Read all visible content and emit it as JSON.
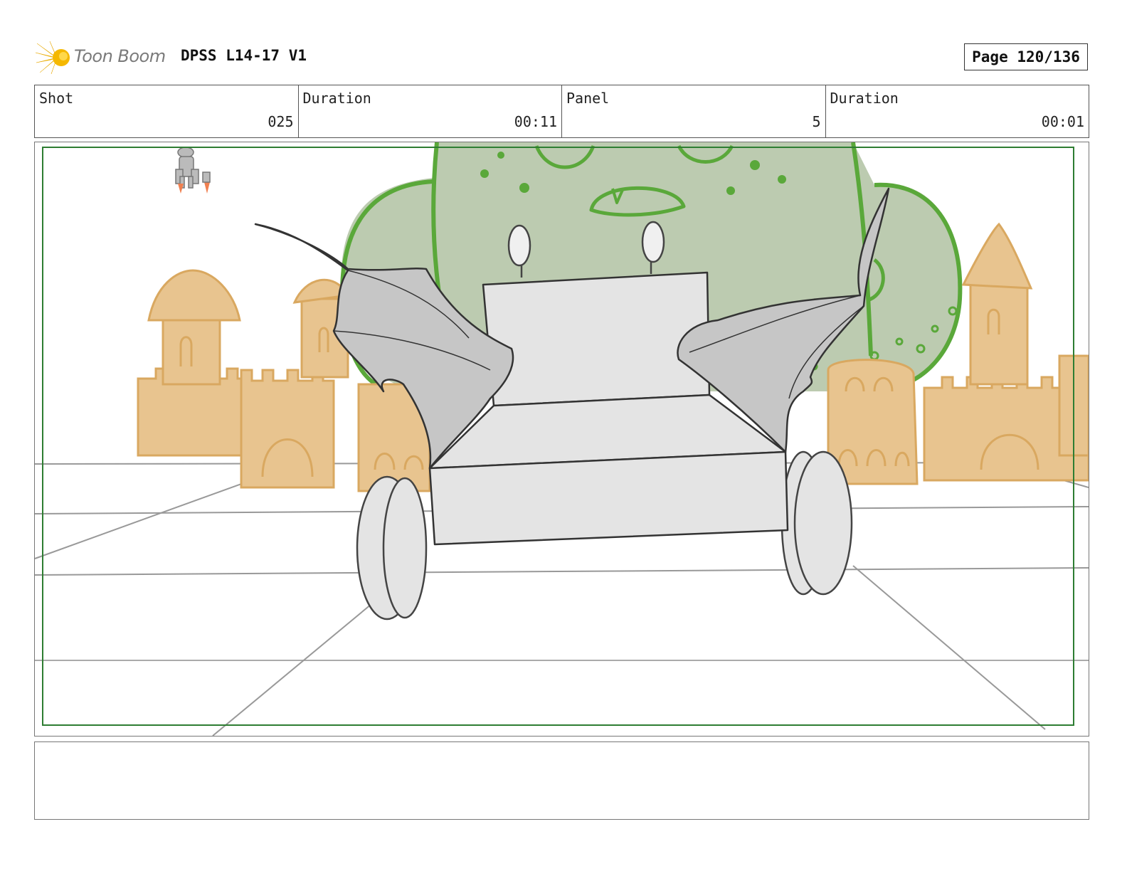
{
  "header": {
    "logo_text": "Toon Boom",
    "title": "DPSS L14-17 V1",
    "page_label": "Page 120/136"
  },
  "info": {
    "shot_label": "Shot",
    "shot_value": "025",
    "shot_duration_label": "Duration",
    "shot_duration_value": "00:11",
    "panel_label": "Panel",
    "panel_value": "5",
    "panel_duration_label": "Duration",
    "panel_duration_value": "00:01"
  },
  "colors": {
    "safe_frame": "#2e7d32",
    "sand": "#e8c48f",
    "sand_line": "#d9a860",
    "monster_fill": "#bccbb0",
    "monster_line": "#5aa83a",
    "cart_fill": "#e4e4e4",
    "wing_fill": "#c6c6c6"
  },
  "notes": {
    "text": ""
  }
}
